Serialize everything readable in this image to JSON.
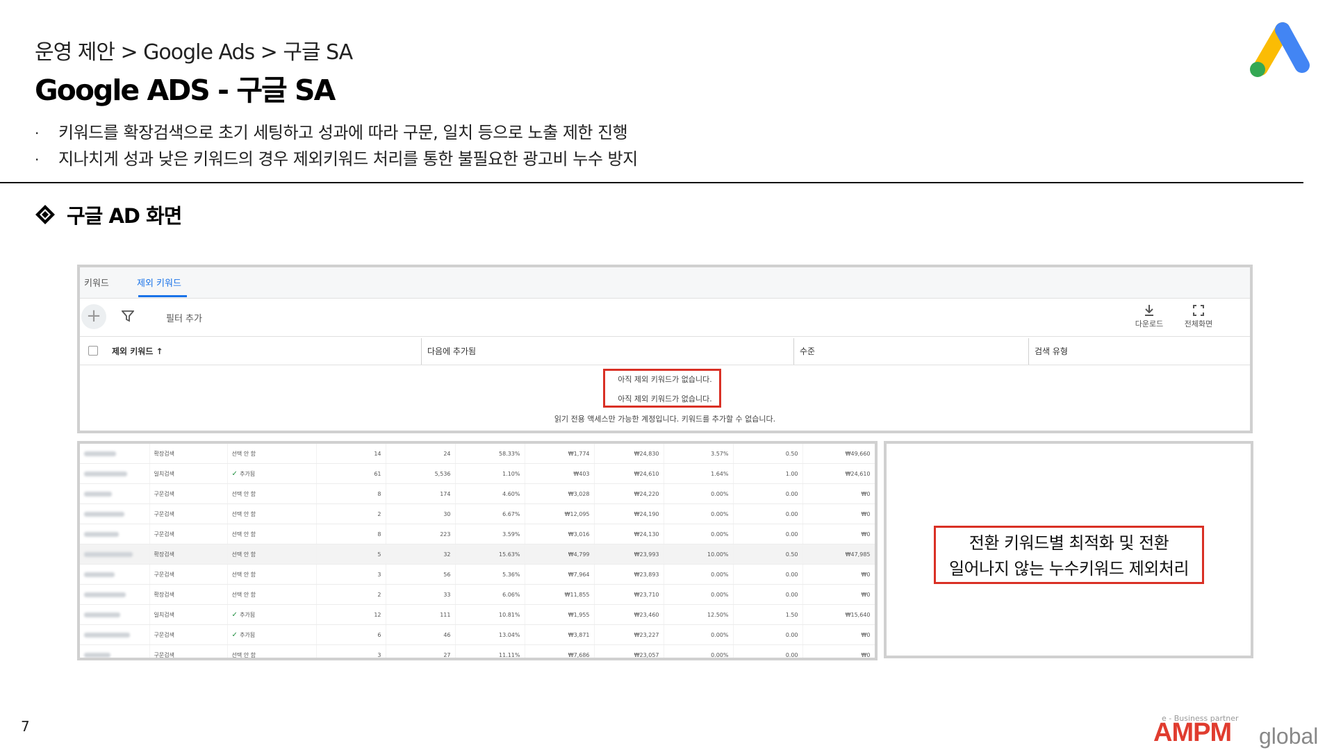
{
  "header": {
    "breadcrumb": "운영 제안 > Google Ads > 구글 SA",
    "title": "Google ADS - 구글 SA"
  },
  "bullets": [
    "키워드를 확장검색으로 초기 세팅하고 성과에 따라 구문, 일치 등으로 노출 제한 진행",
    "지나치게 성과 낮은 키워드의 경우 제외키워드 처리를 통한 불필요한 광고비 누수 방지"
  ],
  "bullet_marker": "·",
  "section_title": "구글 AD 화면",
  "ads_ui": {
    "tabs": [
      "키워드",
      "제외 키워드"
    ],
    "active_tab": 1,
    "add_button": "+",
    "filter_label": "필터 추가",
    "download_label": "다운로드",
    "fullscreen_label": "전체화면",
    "columns": [
      "제외 키워드 ↑",
      "다음에 추가됨",
      "수준",
      "검색 유형"
    ],
    "empty_lines": [
      "아직 제외 키워드가 없습니다.",
      "아직 제외 키워드가 없습니다."
    ],
    "readonly_msg": "읽기 전용 액세스만 가능한 계정입니다. 키워드를 추가할 수 없습니다."
  },
  "keyword_rows": [
    {
      "match": "확장검색",
      "status": "선택 안 함",
      "checked": false,
      "c1": "14",
      "c2": "24",
      "c3": "58.33%",
      "c4": "₩1,774",
      "c5": "₩24,830",
      "c6": "3.57%",
      "c7": "0.50",
      "c8": "₩49,660"
    },
    {
      "match": "일치검색",
      "status": "추가됨",
      "checked": true,
      "c1": "61",
      "c2": "5,536",
      "c3": "1.10%",
      "c4": "₩403",
      "c5": "₩24,610",
      "c6": "1.64%",
      "c7": "1.00",
      "c8": "₩24,610"
    },
    {
      "match": "구문검색",
      "status": "선택 안 함",
      "checked": false,
      "c1": "8",
      "c2": "174",
      "c3": "4.60%",
      "c4": "₩3,028",
      "c5": "₩24,220",
      "c6": "0.00%",
      "c7": "0.00",
      "c8": "₩0"
    },
    {
      "match": "구문검색",
      "status": "선택 안 함",
      "checked": false,
      "c1": "2",
      "c2": "30",
      "c3": "6.67%",
      "c4": "₩12,095",
      "c5": "₩24,190",
      "c6": "0.00%",
      "c7": "0.00",
      "c8": "₩0"
    },
    {
      "match": "구문검색",
      "status": "선택 안 함",
      "checked": false,
      "c1": "8",
      "c2": "223",
      "c3": "3.59%",
      "c4": "₩3,016",
      "c5": "₩24,130",
      "c6": "0.00%",
      "c7": "0.00",
      "c8": "₩0"
    },
    {
      "match": "확장검색",
      "status": "선택 안 함",
      "checked": false,
      "c1": "5",
      "c2": "32",
      "c3": "15.63%",
      "c4": "₩4,799",
      "c5": "₩23,993",
      "c6": "10.00%",
      "c7": "0.50",
      "c8": "₩47,985",
      "highlight": true
    },
    {
      "match": "구문검색",
      "status": "선택 안 함",
      "checked": false,
      "c1": "3",
      "c2": "56",
      "c3": "5.36%",
      "c4": "₩7,964",
      "c5": "₩23,893",
      "c6": "0.00%",
      "c7": "0.00",
      "c8": "₩0"
    },
    {
      "match": "확장검색",
      "status": "선택 안 함",
      "checked": false,
      "c1": "2",
      "c2": "33",
      "c3": "6.06%",
      "c4": "₩11,855",
      "c5": "₩23,710",
      "c6": "0.00%",
      "c7": "0.00",
      "c8": "₩0"
    },
    {
      "match": "일치검색",
      "status": "추가됨",
      "checked": true,
      "c1": "12",
      "c2": "111",
      "c3": "10.81%",
      "c4": "₩1,955",
      "c5": "₩23,460",
      "c6": "12.50%",
      "c7": "1.50",
      "c8": "₩15,640"
    },
    {
      "match": "구문검색",
      "status": "추가됨",
      "checked": true,
      "c1": "6",
      "c2": "46",
      "c3": "13.04%",
      "c4": "₩3,871",
      "c5": "₩23,227",
      "c6": "0.00%",
      "c7": "0.00",
      "c8": "₩0"
    },
    {
      "match": "구문검색",
      "status": "선택 안 함",
      "checked": false,
      "c1": "3",
      "c2": "27",
      "c3": "11.11%",
      "c4": "₩7,686",
      "c5": "₩23,057",
      "c6": "0.00%",
      "c7": "0.00",
      "c8": "₩0"
    }
  ],
  "callout": {
    "line1": "전환 키워드별 최적화 및 전환",
    "line2": "일어나지 않는 누수키워드 제외처리"
  },
  "page_number": "7",
  "footer": {
    "tagline": "e - Business partner",
    "brand": "AMPM",
    "brand2": "global"
  },
  "colors": {
    "accent_blue": "#1a73e8",
    "highlight_red": "#d93025",
    "brand_red": "#e03c2f",
    "logo_yellow": "#fbbc04",
    "logo_blue": "#4285f4",
    "logo_green": "#34a853"
  },
  "icons": [
    "google-ads-logo",
    "filter-icon",
    "download-icon",
    "fullscreen-icon",
    "diamond-bullet-icon",
    "checkmark-icon"
  ]
}
